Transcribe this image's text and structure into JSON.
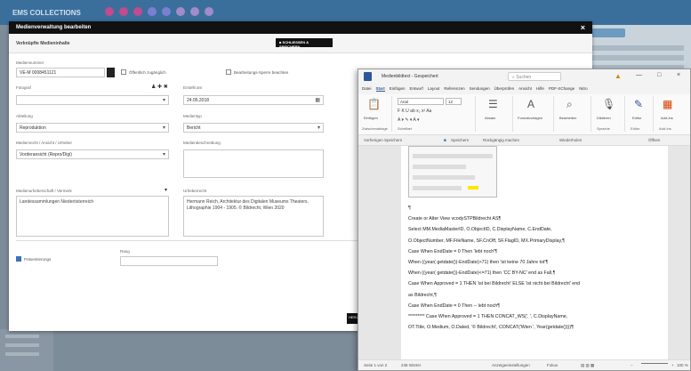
{
  "background": {
    "app_title": "EMS COLLECTIONS"
  },
  "dialog": {
    "title": "Medienverwaltung bearbeiten",
    "close_glyph": "×",
    "subheader": "Verknüpfte Medieninhalte",
    "close_save_button": "■ SCHLIESSEN & SPEICHERN",
    "fields": {
      "medium_number_label": "Mediennummer",
      "medium_number_value": "VE-M 0008451121",
      "public_label": "Öffentlich zugänglich",
      "restricted_label": "Bearbeitungs-Sperre beachten",
      "source_label": "Fotograf",
      "date_label": "Erstellt am",
      "date_value": "24.05.2018",
      "type_label": "Abteilung",
      "type_value": "Reproduktion",
      "medium_label": "Medientyp",
      "medium_value": "Bericht",
      "rights_label": "Medienrecht / Ansicht / Urheber",
      "rights_value": "Vorderansicht (Repro/Digi)",
      "description_label": "Medienbeschreibung",
      "copyright_label": "Medienurheberschaft / Vermerk",
      "copyright_value": "Landessammlungen Niederösterreich",
      "credit_label": "Urheberrecht",
      "credit_value": "Hermann Reich, Architektur des Digitalen Museums Theaters, Lithographie 1904 - 1905. © Bildrecht, Wien 2020",
      "order_label": "Rang",
      "preview_label": "Präsentierungs"
    },
    "dark_tab": "HERUNTER"
  },
  "word": {
    "doc_name": "Medienbildtext - Gespeichert",
    "search_placeholder": "Suchen",
    "window_controls": [
      "—",
      "□",
      "×"
    ],
    "menu": [
      "Datei",
      "Start",
      "Einfügen",
      "Entwurf",
      "Layout",
      "Referenzen",
      "Sendungen",
      "Überprüfen",
      "Ansicht",
      "Hilfe",
      "PDF-XChange",
      "Nitro",
      "Schaltfläche"
    ],
    "active_menu": "Start",
    "ribbon": {
      "paste_label": "Einfügen",
      "clipboard_label": "Zwischenablage",
      "font_name": "Arial",
      "font_size": "12",
      "font_label": "Schriftart",
      "paragraph_label": "Absatz",
      "styles_label": "Formatvorlagen",
      "edit_label": "Bearbeiten",
      "dictate_label": "Diktieren",
      "editor_label": "Editor",
      "addins_label": "Add-Ins",
      "voice_label": "Sprache",
      "editor_group_label": "Editor",
      "addins_group_label": "Add-Ins"
    },
    "quickbar": {
      "left": "Vorherigen Speichern",
      "save": "Speichern",
      "undo": "Rückgängig machen",
      "redo": "Wiederholen",
      "open": "Öffnen"
    },
    "code_lines": [
      "¶",
      "Create or Alter View vcodySTPBildrecht AS¶",
      "Select MM.MediaMasterID, O.ObjectID, C.DisplayName, C.EndDate,",
      "O.ObjectNumber, MF.FileName, SF.CnOff, SF.FlagID, MX.PrimaryDisplay,¶",
      "Case When EndDate = 0 Then 'lebt noch'¶",
      "When ((year( getdate())-EndDate)>71) then 'ist keine 70 Jahre tot'¶",
      "When ((year( getdate())-EndDate)<=71) then 'CC BY-NC' end as Fall,¶",
      "Case When Approved = 1 THEN 'ist bei Bildrecht' ELSE 'ist nicht bei Bildrecht' end",
      "as Bildrecht,¶",
      "Case When EndDate = 0 Then -- lebt noch¶",
      "********* Case When Approved = 1 THEN CONCAT_WS(', ', C.DisplayName,",
      "OT.Title, O.Medium, O.Dated, '© Bildrecht', CONCAT('Wien ', Year(getdate())))¶"
    ],
    "status": {
      "page": "Seite 1 von 2",
      "words": "238 Wörter",
      "focus": "Fokus",
      "display": "Anzeigeeinstellungen",
      "zoom": "100 %"
    }
  }
}
